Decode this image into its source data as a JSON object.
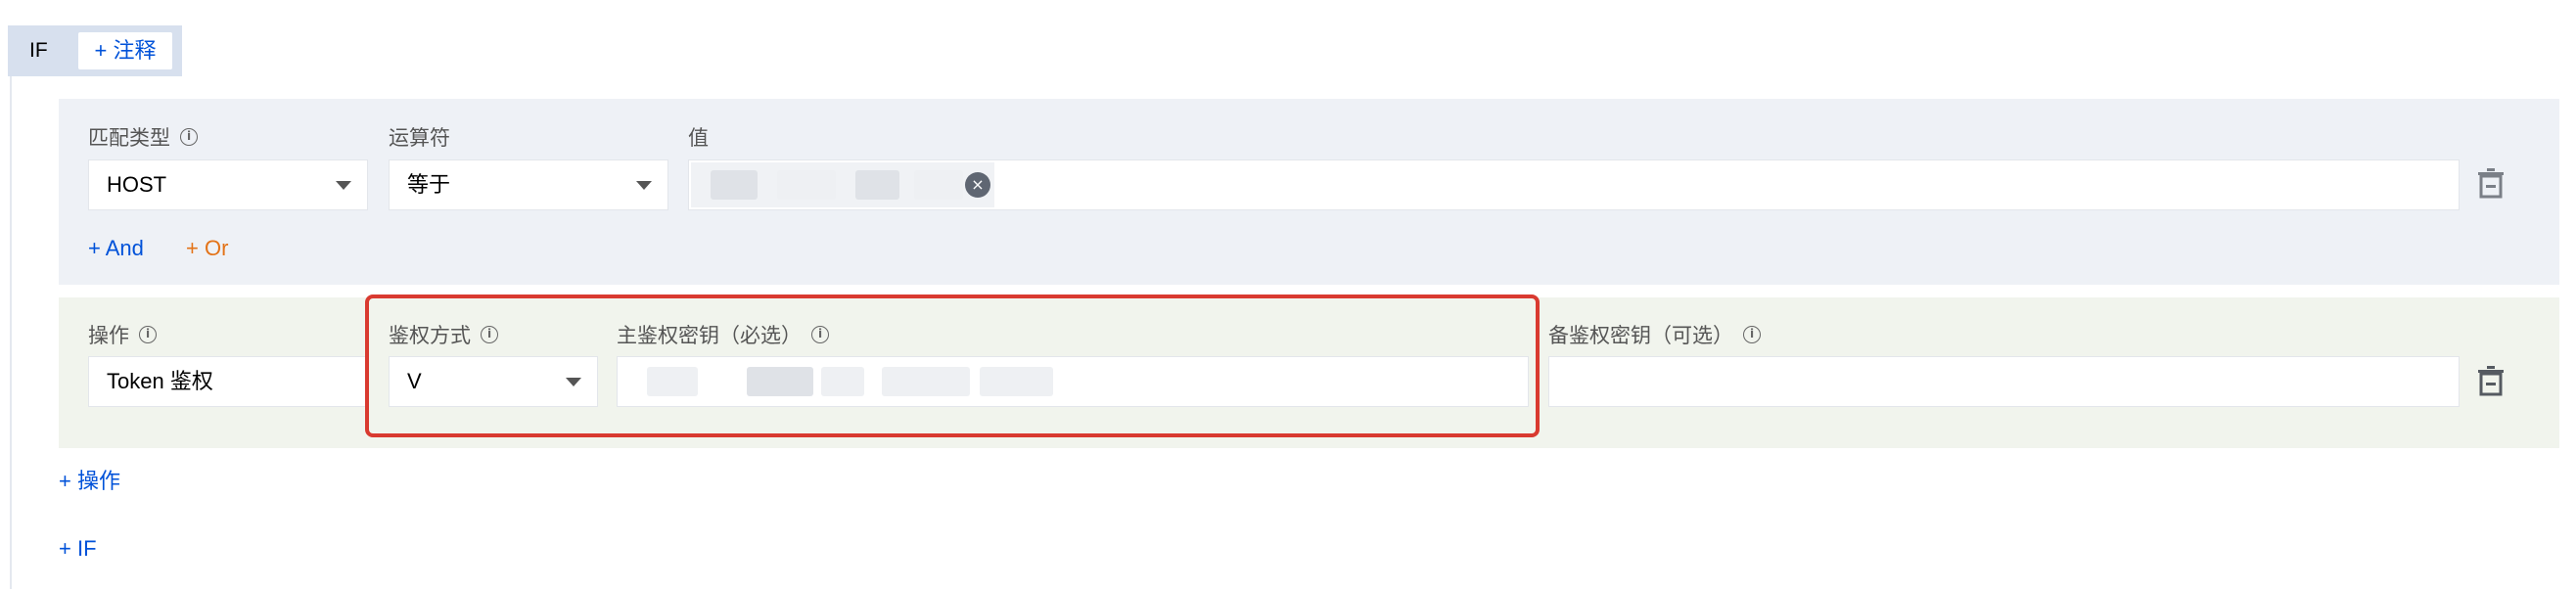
{
  "if_block": {
    "label": "IF",
    "comment_button": "+ 注释"
  },
  "condition": {
    "match_type_label": "匹配类型",
    "operator_label": "运算符",
    "value_label": "值",
    "match_type_value": "HOST",
    "operator_value": "等于",
    "add_and": "+ And",
    "add_or": "+ Or"
  },
  "operation": {
    "action_label": "操作",
    "auth_method_label": "鉴权方式",
    "primary_key_label": "主鉴权密钥（必选）",
    "backup_key_label": "备鉴权密钥（可选）",
    "action_value": "Token 鉴权",
    "auth_method_value": "V"
  },
  "add_operation": "+ 操作",
  "add_if": "+ IF",
  "colors": {
    "accent": "#0052d9",
    "or_link": "#e37318",
    "highlight": "#d93a30"
  }
}
